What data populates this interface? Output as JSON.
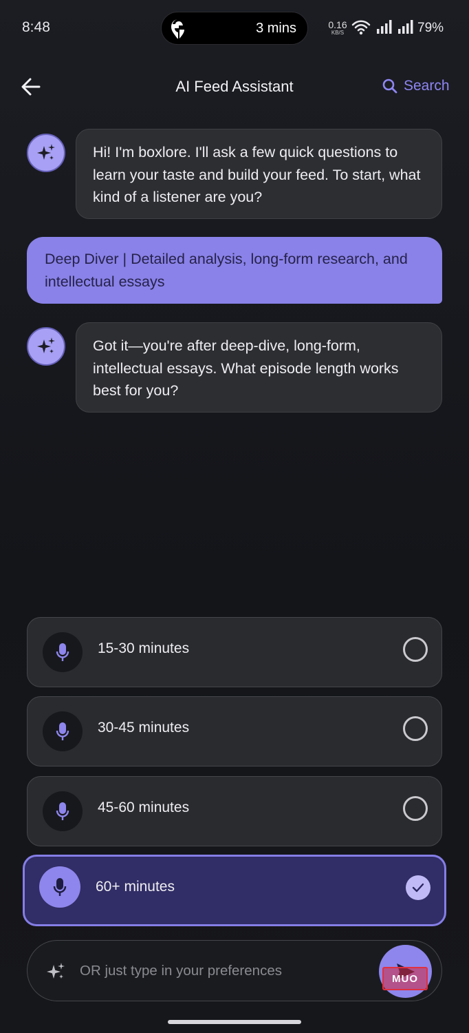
{
  "status_bar": {
    "time": "8:48",
    "live_activity": "3 mins",
    "net_speed_value": "0.16",
    "net_speed_unit": "KB/S",
    "battery": "79%"
  },
  "header": {
    "back_icon": "arrow-left-icon",
    "title": "AI Feed Assistant",
    "search_label": "Search"
  },
  "messages": [
    {
      "role": "assistant",
      "text": "Hi! I'm boxlore. I'll ask a few quick questions to learn your taste and build your feed. To start, what kind of a listener are you?"
    },
    {
      "role": "user",
      "text": "Deep Diver | Detailed analysis, long-form research, and intellectual essays"
    },
    {
      "role": "assistant",
      "text": "Got it—you're after deep-dive, long-form, intellectual essays. What episode length works best for you?"
    }
  ],
  "options": [
    {
      "label": "15-30 minutes",
      "selected": false
    },
    {
      "label": "30-45 minutes",
      "selected": false
    },
    {
      "label": "45-60 minutes",
      "selected": false
    },
    {
      "label": "60+ minutes",
      "selected": true
    }
  ],
  "input": {
    "placeholder": "OR just type in your preferences",
    "value": ""
  },
  "watermark": "MUO",
  "colors": {
    "accent": "#8e86ec",
    "accent_text": "#8f86f2",
    "selected_bg": "#312d66",
    "bubble_ai": "#2d2e32",
    "bubble_user": "#8a82e8"
  }
}
